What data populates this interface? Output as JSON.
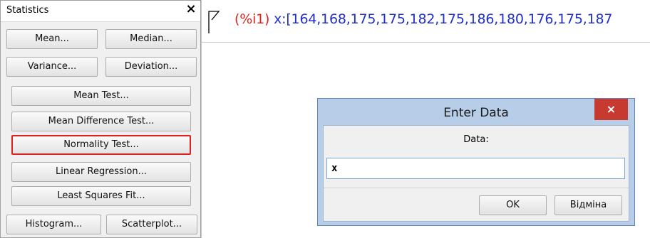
{
  "panel": {
    "title": "Statistics",
    "close_label": "×",
    "buttons": {
      "mean": "Mean...",
      "median": "Median...",
      "variance": "Variance...",
      "deviation": "Deviation...",
      "mean_test": "Mean Test...",
      "mean_difference_test": "Mean Difference Test...",
      "normality_test": "Normality Test...",
      "linear_regression": "Linear Regression...",
      "least_squares_fit": "Least Squares Fit...",
      "histogram": "Histogram...",
      "scatterplot": "Scatterplot..."
    }
  },
  "notebook": {
    "input_label": "(%i1)",
    "input_code": "x:[164,168,175,175,182,175,186,180,176,175,187"
  },
  "dialog": {
    "title": "Enter Data",
    "close_label": "×",
    "data_label": "Data:",
    "data_value": "x",
    "ok_label": "OK",
    "cancel_label": "Відміна"
  },
  "colors": {
    "input_label": "#e0251f",
    "input_code": "#2030c8",
    "highlight": "#e02020",
    "dialog_close": "#c63a30"
  }
}
